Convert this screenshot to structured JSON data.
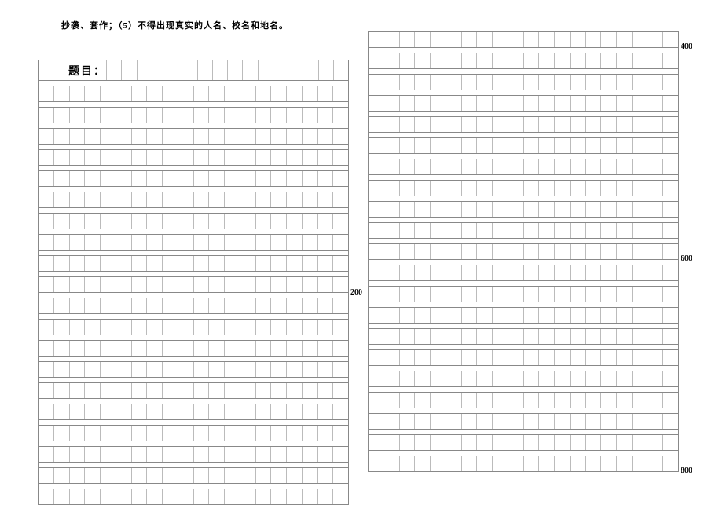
{
  "instruction_text": "抄袭、套作；（5）不得出现真实的人名、校名和地名。",
  "title_label": "题目：",
  "markers": {
    "m200": "200",
    "m400": "400",
    "m600": "600",
    "m800": "800"
  },
  "grid": {
    "cells_per_row": 20,
    "title_trailing_cells": 16,
    "colA_rows": 20,
    "colB_rows": 21,
    "marker_rows": {
      "colA_200": 10,
      "colB_400": 1,
      "colB_600": 11,
      "colB_800": 21
    }
  }
}
